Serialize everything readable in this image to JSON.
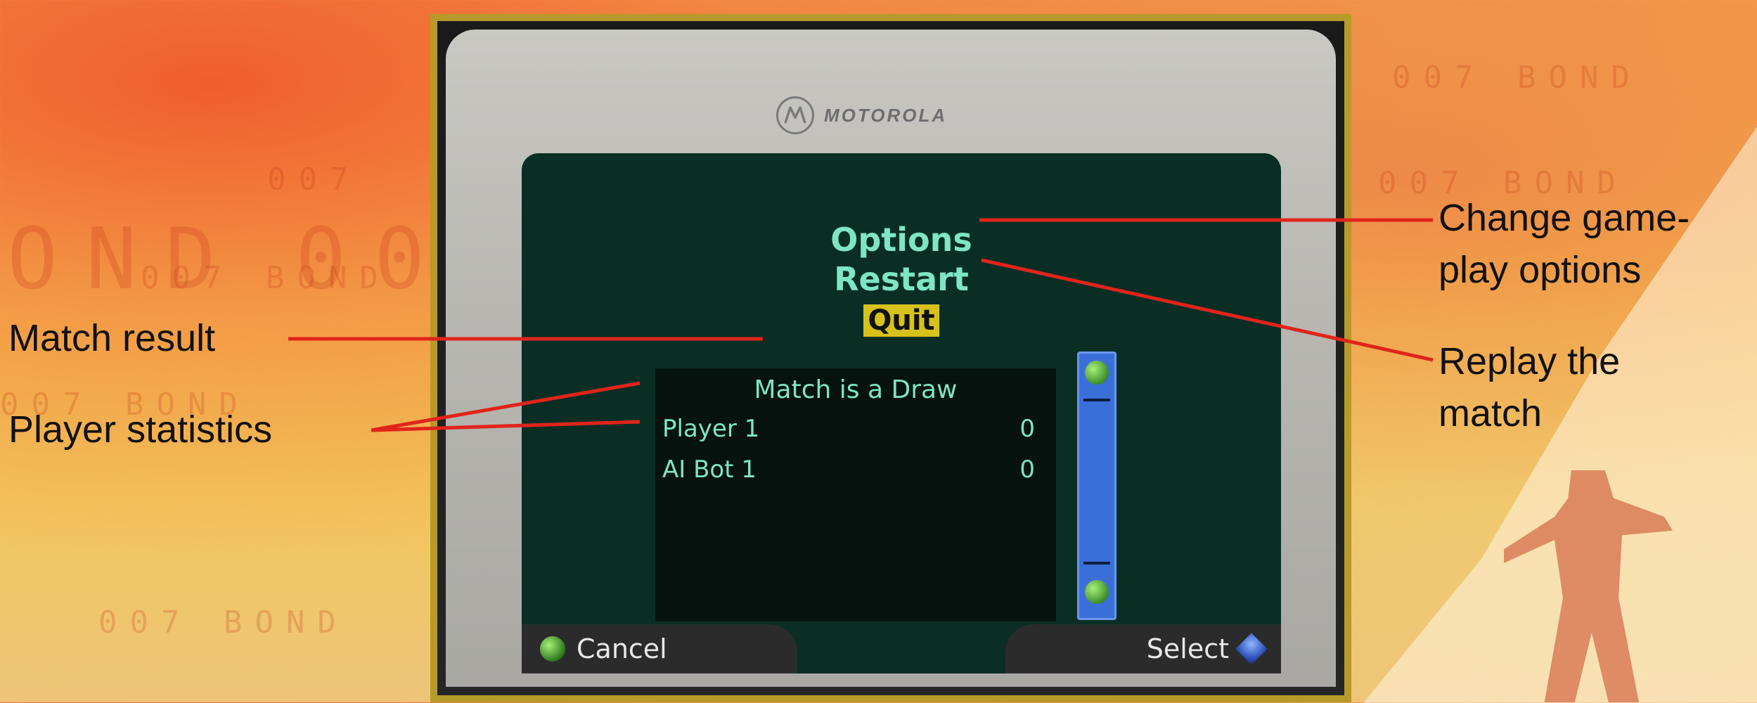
{
  "phone": {
    "brand": "MOTOROLA"
  },
  "menu": {
    "items": [
      {
        "label": "Options",
        "selected": false
      },
      {
        "label": "Restart",
        "selected": false
      },
      {
        "label": "Quit",
        "selected": true
      }
    ]
  },
  "results": {
    "title": "Match is a Draw",
    "rows": [
      {
        "name": "Player 1",
        "score": "0"
      },
      {
        "name": "AI Bot 1",
        "score": "0"
      }
    ]
  },
  "softkeys": {
    "left": "Cancel",
    "right": "Select"
  },
  "callouts": {
    "match_result": "Match result",
    "player_statistics": "Player statistics",
    "options_line1": "Change game-",
    "options_line2": "play options",
    "restart_line1": "Replay the",
    "restart_line2": "match"
  },
  "background": {
    "texts": [
      "007",
      "BOND",
      "007 BOND"
    ]
  },
  "colors": {
    "screen_text": "#7ee6c4",
    "selected_bg": "#d6c21a",
    "callout_line": "#e0241b",
    "frame_gold": "#b79a2a"
  },
  "icons": {
    "brand_logo": "motorola-logo-icon",
    "scroll_up": "scroll-up-icon",
    "scroll_down": "scroll-down-icon",
    "left_softkey": "green-softkey-icon",
    "right_softkey": "blue-diamond-softkey-icon"
  }
}
